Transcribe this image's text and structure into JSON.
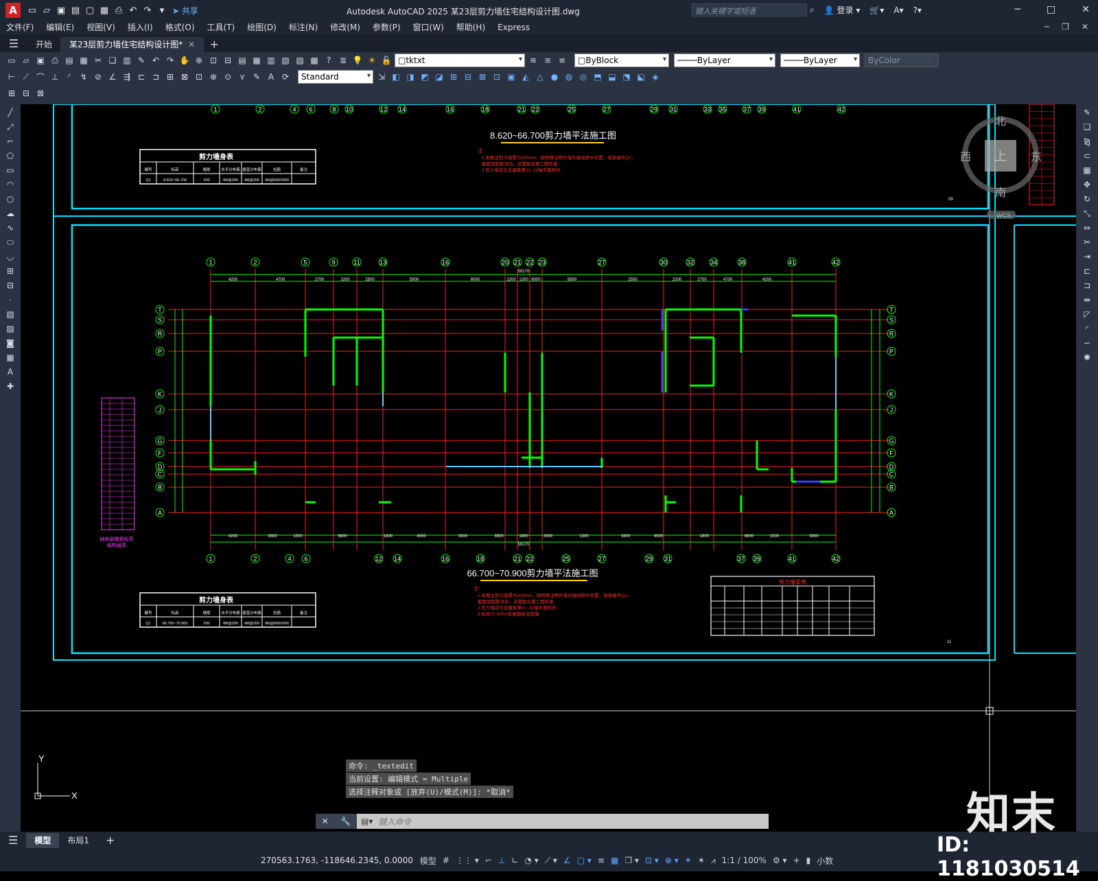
{
  "title_bar": {
    "app_icon": "A",
    "share": "共享",
    "title": "Autodesk AutoCAD 2025    某23层剪力墙住宅结构设计图.dwg",
    "search_placeholder": "键入关键字或短语",
    "login": "登录"
  },
  "menu": [
    "文件(F)",
    "编辑(E)",
    "视图(V)",
    "插入(I)",
    "格式(O)",
    "工具(T)",
    "绘图(D)",
    "标注(N)",
    "修改(M)",
    "参数(P)",
    "窗口(W)",
    "帮助(H)",
    "Express"
  ],
  "tabs": {
    "start": "开始",
    "active": "某23层剪力墙住宅结构设计图*"
  },
  "toolbar": {
    "layer": "tktxt",
    "textstyle": "Standard",
    "color": "ByBlock",
    "linetype": "ByLayer",
    "lineweight": "ByLayer",
    "plotstyle": "ByColor"
  },
  "viewcube": {
    "north": "北",
    "south": "南",
    "east": "东",
    "west": "西",
    "top": "上",
    "wcs": "WCS"
  },
  "drawing": {
    "title_top": "8.620~66.700剪力墙平法施工图",
    "title_bottom": "66.700~70.900剪力墙平法施工图",
    "table_title": "剪力墙身表",
    "table_headers": [
      "编号",
      "标高",
      "墙厚",
      "水平分布筋",
      "垂直分布筋",
      "拉筋",
      "备注"
    ],
    "table_row_top": [
      "Q1",
      "8.620~66.700",
      "200",
      "Ф8@200",
      "Ф8@200",
      "Ф6@600X600",
      ""
    ],
    "table_row_bottom": [
      "Q1",
      "66.700~70.900",
      "200",
      "Ф8@200",
      "Ф8@200",
      "Ф6@600X600",
      ""
    ],
    "note_label": "注:",
    "notes_top": [
      "1.本图注剪力墙厚为200mm，除特殊注明外墙与轴线居中布置，墙身编号Q1，",
      "截面及配筋详见，还需配合施工图检查.",
      "2.剪力墙定位见建筑第21~22轴平面构件."
    ],
    "notes_bottom": [
      "1.本图注剪力墙厚为200mm，除特殊注明外墙与轴线居中布置，墙身编号Q1，",
      "截面及配筋详见，还需配合施工图检查.",
      "2.剪力墙定位见建筑第21~22轴平面构件.",
      "3.标高70.000m处屋面板见结施."
    ],
    "sheet_top": "09",
    "sheet_bottom": "11",
    "beam_table_title": "剪力墙梁表",
    "storey_caption": [
      "结构层楼面标高",
      "结构层高"
    ],
    "top_axes": [
      "1",
      "2",
      "5",
      "9",
      "11",
      "13",
      "16",
      "20",
      "21",
      "22",
      "23",
      "27",
      "30",
      "32",
      "34",
      "38",
      "41",
      "42"
    ],
    "bottom_axes": [
      "1",
      "2",
      "4",
      "6",
      "12",
      "14",
      "16",
      "18",
      "21",
      "22",
      "25",
      "27",
      "29",
      "31",
      "37",
      "39",
      "41",
      "42"
    ],
    "partial_axes": [
      "1",
      "2",
      "4",
      "6",
      "8",
      "10",
      "12",
      "14",
      "16",
      "18",
      "21",
      "22",
      "25",
      "27",
      "29",
      "31",
      "33",
      "35",
      "37",
      "39",
      "41",
      "42"
    ],
    "row_axes_left": [
      "T",
      "S",
      "R",
      "P",
      "K",
      "J",
      "G",
      "F",
      "D",
      "C",
      "B",
      "A"
    ],
    "top_dims": [
      "4200",
      "4700",
      "2700",
      "2200",
      "2500",
      "5900",
      "6000",
      "1200",
      "1200",
      "6000",
      "5900",
      "2500",
      "2200",
      "2700",
      "4700",
      "4200"
    ],
    "bottom_dims": [
      "4200",
      "3300",
      "1500",
      "6900",
      "1800",
      "4500",
      "3300",
      "3900",
      "1800",
      "2600",
      "1300",
      "3300",
      "4500",
      "1800",
      "6900",
      "1500",
      "3300",
      "4200"
    ],
    "total_dim": "59170"
  },
  "command": {
    "history": [
      "命令: _textedit",
      "当前设置: 编辑模式 = Multiple",
      "选择注释对象或 [放弃(U)/模式(M)]: *取消*"
    ],
    "placeholder": "键入命令"
  },
  "layout_tabs": [
    "模型",
    "布局1"
  ],
  "status": {
    "coords": "270563.1763, -118646.2345, 0.0000",
    "model": "模型",
    "scale": "1:1 / 100%",
    "units": "小数"
  },
  "watermark": {
    "brand": "知末",
    "id": "ID: 1181030514"
  },
  "colors": {
    "ui_dark": "#1f2633",
    "ui_mid": "#2b3342",
    "cyan": "#00e5ff",
    "green": "#00ff00",
    "red": "#ff2020"
  }
}
